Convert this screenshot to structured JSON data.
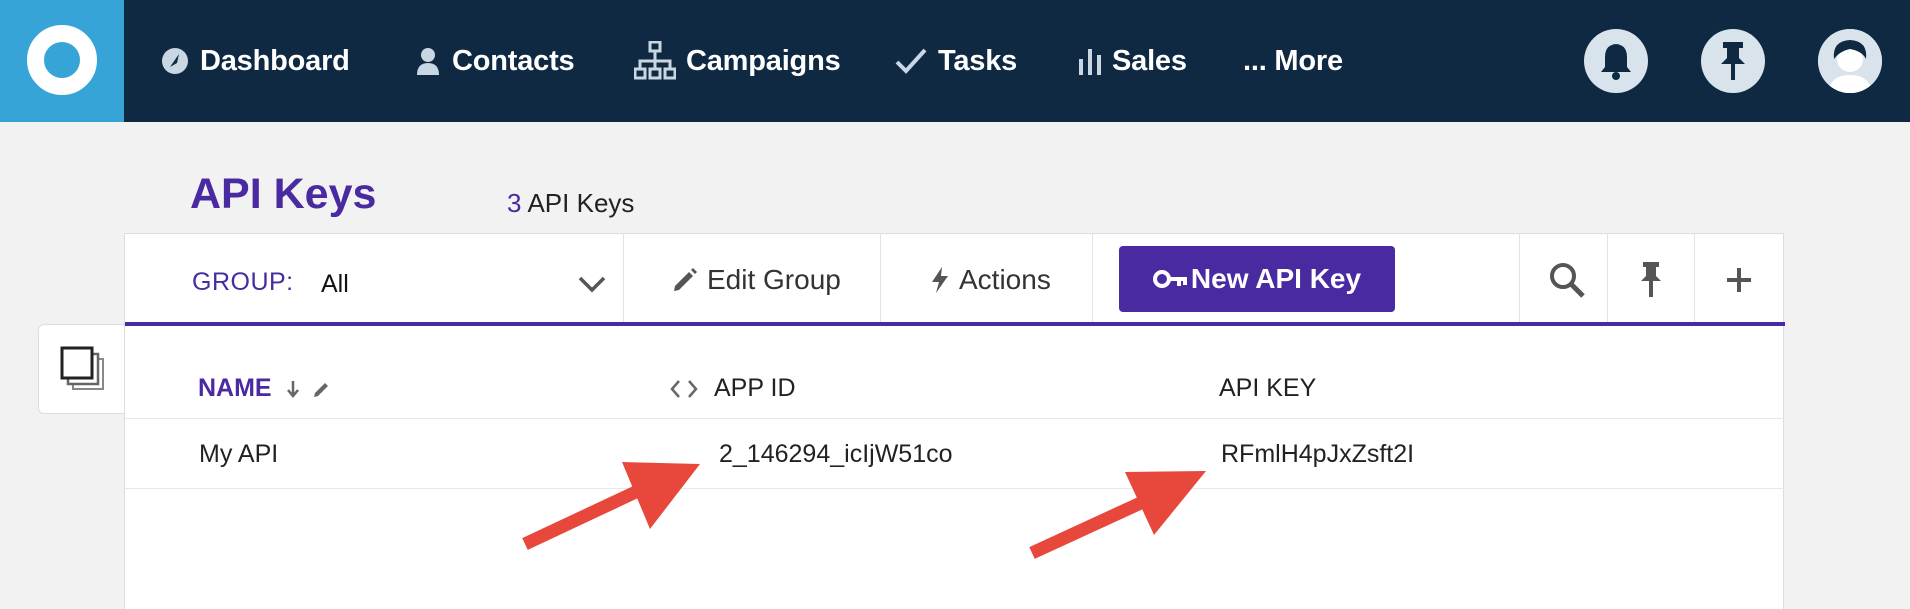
{
  "nav": {
    "items": [
      {
        "label": "Dashboard",
        "icon": "dashboard-icon"
      },
      {
        "label": "Contacts",
        "icon": "contacts-icon"
      },
      {
        "label": "Campaigns",
        "icon": "campaigns-icon"
      },
      {
        "label": "Tasks",
        "icon": "tasks-icon"
      },
      {
        "label": "Sales",
        "icon": "sales-icon"
      },
      {
        "label": "... More",
        "icon": ""
      }
    ],
    "right_icons": [
      "bell-icon",
      "pin-icon",
      "avatar"
    ]
  },
  "page": {
    "title": "API Keys",
    "count": "3",
    "count_label": "API Keys"
  },
  "toolbar": {
    "group_label": "GROUP:",
    "group_value": "All",
    "edit_group": "Edit Group",
    "actions": "Actions",
    "new_key": "New API Key",
    "icons": [
      "search-icon",
      "pin-icon",
      "plus-icon"
    ]
  },
  "table": {
    "headers": {
      "name": "NAME",
      "app_id": "APP ID",
      "api_key": "API KEY"
    },
    "rows": [
      {
        "name": "My API",
        "app_id": "2_146294_icIjW51co",
        "api_key": "RFmlH4pJxZsft2I"
      }
    ]
  },
  "colors": {
    "nav_bg": "#0f2942",
    "logo_bg": "#36a4d6",
    "accent": "#4a2aa0",
    "arrow": "#e8483b"
  }
}
